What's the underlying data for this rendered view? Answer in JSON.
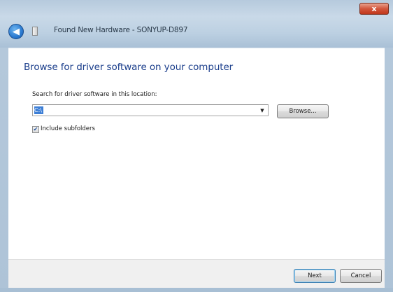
{
  "window": {
    "title": "Found New Hardware - SONYUP-D897",
    "close_label": "x"
  },
  "page": {
    "heading": "Browse for driver software on your computer",
    "search_label": "Search for driver software in this location:",
    "location_value": "C:\\",
    "browse_label": "Browse...",
    "include_subfolders_label": "Include subfolders",
    "include_subfolders_checked": true
  },
  "footer": {
    "next_label": "Next",
    "cancel_label": "Cancel"
  },
  "colors": {
    "heading": "#1c3f8c",
    "selection": "#3d7fd6",
    "frame": "#bcd0e2"
  },
  "icons": {
    "back": "back-arrow-icon",
    "hardware": "hardware-icon",
    "dropdown": "chevron-down-icon",
    "checkmark": "checkmark-icon"
  }
}
